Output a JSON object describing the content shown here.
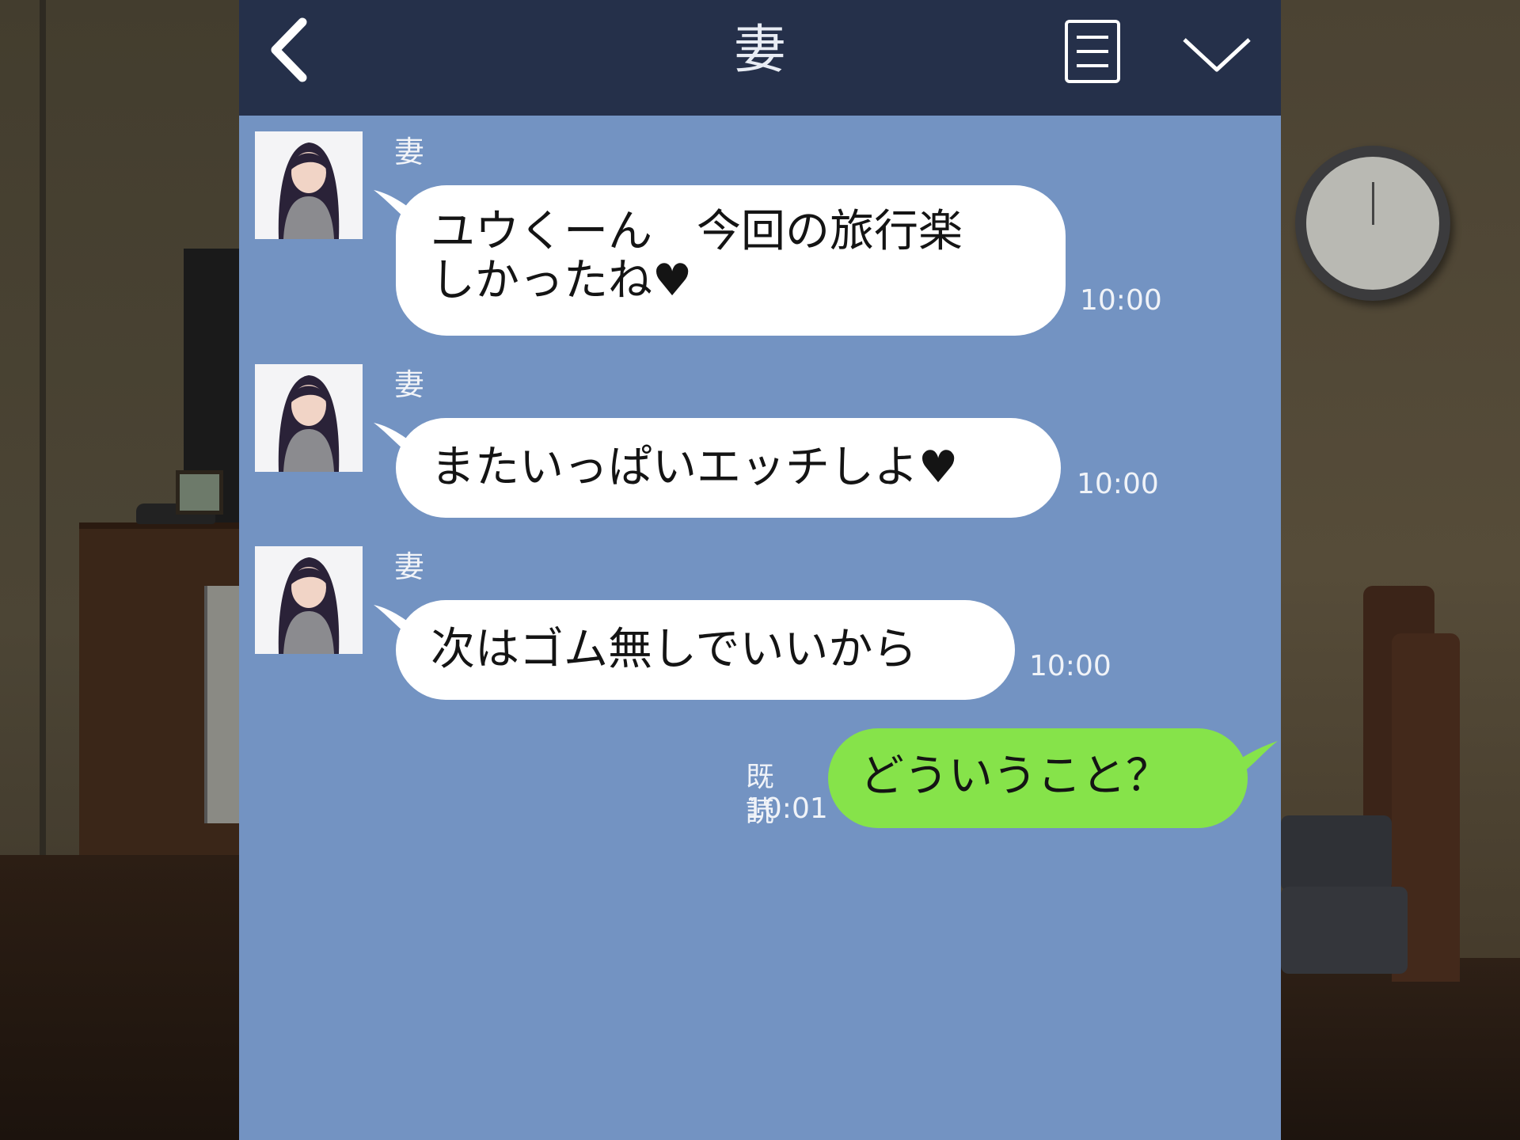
{
  "header": {
    "title": "妻"
  },
  "messages": [
    {
      "sender": "妻",
      "text": "ユウくーん　今回の旅行楽\nしかったね♥",
      "time": "10:00"
    },
    {
      "sender": "妻",
      "text": "またいっぱいエッチしよ♥",
      "time": "10:00"
    },
    {
      "sender": "妻",
      "text": "次はゴム無しでいいから",
      "time": "10:00"
    }
  ],
  "my_message": {
    "text": "どういうこと？",
    "read_status": "既読",
    "time": "10:01"
  },
  "colors": {
    "header_bg": "#25304a",
    "chat_bg": "#7393c2",
    "incoming_bubble": "#ffffff",
    "outgoing_bubble": "#86e34a"
  },
  "icons": {
    "back": "chevron-left-icon",
    "menu": "menu-lines-icon",
    "collapse": "chevron-down-icon"
  }
}
